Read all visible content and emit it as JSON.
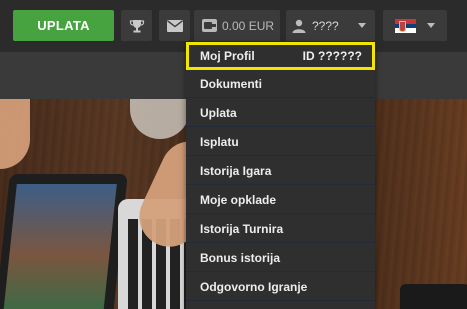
{
  "header": {
    "deposit_label": "UPLATA",
    "balance": "0.00 EUR",
    "username": "????",
    "trophy_icon": "trophy-icon",
    "mail_icon": "mail-icon",
    "wallet_icon": "wallet-icon",
    "user_icon": "user-icon",
    "flag_icon": "serbia-flag-icon"
  },
  "menu": {
    "profile": {
      "label": "Moj Profil",
      "id": "ID ??????"
    },
    "items": [
      "Dokumenti",
      "Uplata",
      "Isplatu",
      "Istorija Igara",
      "Moje opklade",
      "Istorija Turnira",
      "Bonus istorija",
      "Odgovorno Igranje"
    ]
  },
  "colors": {
    "deposit_green": "#47a33f",
    "highlight_yellow": "#f2e600",
    "menu_bg": "#2f2f2f",
    "header_bg": "#2b2b2b"
  }
}
